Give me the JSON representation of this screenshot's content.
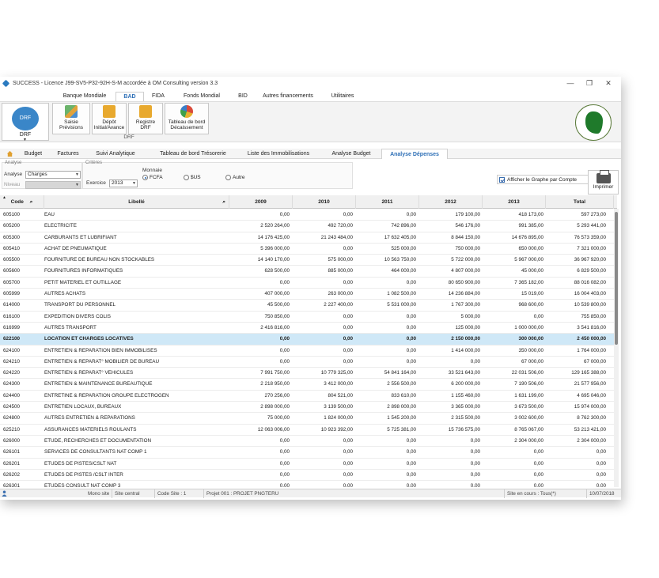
{
  "window": {
    "title": "SUCCESS - Licence J99-SV5-P32-92H-S-M accordée à OM Consulting   version 3.3",
    "controls": {
      "minimize": "—",
      "maximize": "❐",
      "close": "✕"
    }
  },
  "menu_tabs": [
    "Banque Mondiale",
    "BAD",
    "FIDA",
    "Fonds Mondial",
    "BID",
    "Autres financements",
    "Utilitaires"
  ],
  "ribbon": {
    "drf_label": "DRF",
    "drf_sub": "DRF",
    "buttons": [
      {
        "line1": "Saisie",
        "line2": "Prévisions",
        "icon": "chart-doc-icon"
      },
      {
        "line1": "Dépôt",
        "line2": "Initial/Avance",
        "icon": "folder-icon"
      },
      {
        "line1": "Registre",
        "line2": "DRF",
        "icon": "folder-icon"
      },
      {
        "line1": "Tableau de bord",
        "line2": "Décaissement",
        "icon": "pie-chart-icon"
      }
    ],
    "group_label": "DRF"
  },
  "nav_tabs": [
    "Budget",
    "Factures",
    "Suivi Analytique",
    "Tableau de bord Trésorerie",
    "Liste des Immobilisations",
    "Analyse Budget",
    "Analyse Dépenses"
  ],
  "filters": {
    "analyse_section": "Analyse",
    "criteres_section": "Critères",
    "analyse_label": "Analyse",
    "analyse_value": "Charges",
    "niveau_label": "Niveau",
    "niveau_value": "",
    "exercice_label": "Exercice",
    "exercice_value": "2013",
    "monnaie_label": "Monnaie",
    "monnaie_options": [
      "FCFA",
      "$US",
      "Autre"
    ],
    "monnaie_selected": "FCFA",
    "graph_checkbox_label": "Afficher le Graphe par Compte",
    "print_label": "Imprimer"
  },
  "table": {
    "headers": {
      "code": "Code",
      "libelle": "Libellé",
      "y2009": "2009",
      "y2010": "2010",
      "y2011": "2011",
      "y2012": "2012",
      "y2013": "2013",
      "total": "Total"
    },
    "rows": [
      {
        "code": "605100",
        "libelle": "EAU",
        "y2009": "0,00",
        "y2010": "0,00",
        "y2011": "0,00",
        "y2012": "179 100,00",
        "y2013": "418 173,00",
        "total": "597 273,00"
      },
      {
        "code": "605200",
        "libelle": "ELECTRICITE",
        "y2009": "2 520 264,00",
        "y2010": "492 720,00",
        "y2011": "742 896,00",
        "y2012": "546 176,00",
        "y2013": "991 385,00",
        "total": "5 293 441,00"
      },
      {
        "code": "605300",
        "libelle": "CARBURANTS ET LUBRIFIANT",
        "y2009": "14 176 425,00",
        "y2010": "21 243 484,00",
        "y2011": "17 632 405,00",
        "y2012": "8 844 150,00",
        "y2013": "14 676 895,00",
        "total": "76 573 359,00"
      },
      {
        "code": "605410",
        "libelle": "ACHAT DE PNEUMATIQUE",
        "y2009": "5 396 000,00",
        "y2010": "0,00",
        "y2011": "525 000,00",
        "y2012": "750 000,00",
        "y2013": "650 000,00",
        "total": "7 321 000,00"
      },
      {
        "code": "605500",
        "libelle": "FOURNITURE DE BUREAU NON STOCKABLES",
        "y2009": "14 140 170,00",
        "y2010": "575 000,00",
        "y2011": "10 563 750,00",
        "y2012": "5 722 000,00",
        "y2013": "5 967 000,00",
        "total": "36 967 920,00"
      },
      {
        "code": "605600",
        "libelle": "FOURNITURES INFORMATIQUES",
        "y2009": "628 500,00",
        "y2010": "885 000,00",
        "y2011": "464 000,00",
        "y2012": "4 807 000,00",
        "y2013": "45 000,00",
        "total": "6 829 500,00"
      },
      {
        "code": "605700",
        "libelle": "PETIT MATERIEL ET OUTILLAGE",
        "y2009": "0,00",
        "y2010": "0,00",
        "y2011": "0,00",
        "y2012": "80 650 900,00",
        "y2013": "7 365 182,00",
        "total": "88 016 082,00"
      },
      {
        "code": "605999",
        "libelle": "AUTRES ACHATS",
        "y2009": "407 000,00",
        "y2010": "263 000,00",
        "y2011": "1 082 500,00",
        "y2012": "14 236 884,00",
        "y2013": "15 019,00",
        "total": "16 004 403,00"
      },
      {
        "code": "614000",
        "libelle": "TRANSPORT DU PERSONNEL",
        "y2009": "45 500,00",
        "y2010": "2 227 400,00",
        "y2011": "5 531 000,00",
        "y2012": "1 767 300,00",
        "y2013": "968 600,00",
        "total": "10 539 800,00"
      },
      {
        "code": "616100",
        "libelle": "EXPEDITION DIVERS COLIS",
        "y2009": "750 850,00",
        "y2010": "0,00",
        "y2011": "0,00",
        "y2012": "5 000,00",
        "y2013": "0,00",
        "total": "755 850,00"
      },
      {
        "code": "616999",
        "libelle": "AUTRES TRANSPORT",
        "y2009": "2 416 816,00",
        "y2010": "0,00",
        "y2011": "0,00",
        "y2012": "125 000,00",
        "y2013": "1 000 000,00",
        "total": "3 541 816,00"
      },
      {
        "code": "622100",
        "libelle": "LOCATION  ET CHARGES LOCATIVES",
        "y2009": "0,00",
        "y2010": "0,00",
        "y2011": "0,00",
        "y2012": "2 150 000,00",
        "y2013": "300 000,00",
        "total": "2 450 000,00",
        "highlight": true
      },
      {
        "code": "624100",
        "libelle": "ENTRETIEN & REPARATION BIEN IMMOBILISES",
        "y2009": "0,00",
        "y2010": "0,00",
        "y2011": "0,00",
        "y2012": "1 414 000,00",
        "y2013": "350 000,00",
        "total": "1 764 000,00"
      },
      {
        "code": "624210",
        "libelle": "ENTRETIEN & REPARAT° MOBILIER DE BUREAU",
        "y2009": "0,00",
        "y2010": "0,00",
        "y2011": "0,00",
        "y2012": "0,00",
        "y2013": "67 000,00",
        "total": "67 000,00"
      },
      {
        "code": "624220",
        "libelle": "ENTRETIEN & REPARAT° VEHICULES",
        "y2009": "7 991 750,00",
        "y2010": "10 779 325,00",
        "y2011": "54 841 164,00",
        "y2012": "33 521 643,00",
        "y2013": "22 031 506,00",
        "total": "129 165 388,00"
      },
      {
        "code": "624300",
        "libelle": "ENTRETIEN & MAINTENANCE BUREAUTIQUE",
        "y2009": "2 218 950,00",
        "y2010": "3 412 000,00",
        "y2011": "2 556 500,00",
        "y2012": "6 200 000,00",
        "y2013": "7 190 506,00",
        "total": "21 577 956,00"
      },
      {
        "code": "624400",
        "libelle": "ENTRETINE & REPARATION GROUPE ELECTROGEN",
        "y2009": "270 256,00",
        "y2010": "804 521,00",
        "y2011": "833 610,00",
        "y2012": "1 155 460,00",
        "y2013": "1 631 199,00",
        "total": "4 695 046,00"
      },
      {
        "code": "624500",
        "libelle": "ENTRETIEN LOCAUX, BUREAUX",
        "y2009": "2 898 000,00",
        "y2010": "3 139 500,00",
        "y2011": "2 898 000,00",
        "y2012": "3 365 000,00",
        "y2013": "3 673 500,00",
        "total": "15 974 000,00"
      },
      {
        "code": "624800",
        "libelle": "AUTRES ENTRETIEN & REPARATIONS",
        "y2009": "75 000,00",
        "y2010": "1 824 000,00",
        "y2011": "1 545 200,00",
        "y2012": "2 315 500,00",
        "y2013": "3 002 600,00",
        "total": "8 762 300,00"
      },
      {
        "code": "625210",
        "libelle": "ASSURANCES MATERIELS ROULANTS",
        "y2009": "12 063 006,00",
        "y2010": "10 923 392,00",
        "y2011": "5 725 381,00",
        "y2012": "15 736 575,00",
        "y2013": "8 765 067,00",
        "total": "53 213 421,00"
      },
      {
        "code": "626000",
        "libelle": "ETUDE, RECHERCHES ET DOCUMENTATION",
        "y2009": "0,00",
        "y2010": "0,00",
        "y2011": "0,00",
        "y2012": "0,00",
        "y2013": "2 304 000,00",
        "total": "2 304 000,00"
      },
      {
        "code": "626101",
        "libelle": "SERVICES DE CONSULTANTS NAT COMP 1",
        "y2009": "0,00",
        "y2010": "0,00",
        "y2011": "0,00",
        "y2012": "0,00",
        "y2013": "0,00",
        "total": "0,00"
      },
      {
        "code": "626201",
        "libelle": "ETUDES DE PISTES/CSLT NAT",
        "y2009": "0,00",
        "y2010": "0,00",
        "y2011": "0,00",
        "y2012": "0,00",
        "y2013": "0,00",
        "total": "0,00"
      },
      {
        "code": "626202",
        "libelle": "ETUDES DE PISTES /CSLT INTER",
        "y2009": "0,00",
        "y2010": "0,00",
        "y2011": "0,00",
        "y2012": "0,00",
        "y2013": "0,00",
        "total": "0,00"
      },
      {
        "code": "626301",
        "libelle": "ETUDES CONSULT NAT COMP 3",
        "y2009": "0,00",
        "y2010": "0,00",
        "y2011": "0,00",
        "y2012": "0,00",
        "y2013": "0,00",
        "total": "0,00"
      }
    ]
  },
  "status_bar": {
    "mono_site": "Mono site",
    "site": "Site central",
    "code_site": "Code Site : 1",
    "projet": "Projet 001 : PROJET PNGTERU",
    "site_en_cours": "Site en cours : Tous(*)",
    "date": "10/07/2018"
  },
  "colors": {
    "accent": "#2d6fb6",
    "highlight_row": "#cfe8f7",
    "drf_circle": "#3a86c8"
  }
}
